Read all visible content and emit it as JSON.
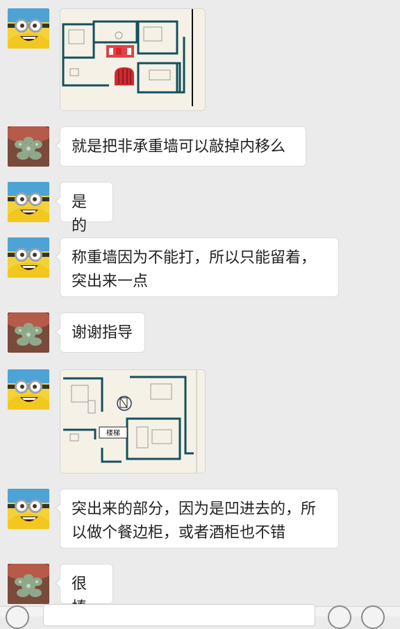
{
  "messages": [
    {
      "sender": "minion",
      "type": "image",
      "content": "floorplan-1"
    },
    {
      "sender": "succulent",
      "type": "text",
      "text": "就是把非承重墙可以敲掉内移么"
    },
    {
      "sender": "minion",
      "type": "text",
      "text": "是的"
    },
    {
      "sender": "minion",
      "type": "text",
      "text": "称重墙因为不能打，所以只能留着，\n突出来一点"
    },
    {
      "sender": "succulent",
      "type": "text",
      "text": "谢谢指导"
    },
    {
      "sender": "minion",
      "type": "image",
      "content": "floorplan-2",
      "label": "楼梯"
    },
    {
      "sender": "minion",
      "type": "text",
      "text": "突出来的部分，因为是凹进去的，所\n以做个餐边柜，或者酒柜也不错"
    },
    {
      "sender": "succulent",
      "type": "text",
      "text": "很棒"
    }
  ],
  "colors": {
    "background": "#ebebeb",
    "bubble": "#ffffff",
    "wall": "#14505e",
    "highlight": "#d8262b",
    "plan_bg": "#f5f1e6"
  },
  "icons": [
    "minion-avatar",
    "succulent-avatar",
    "voice-icon",
    "emoji-icon",
    "plus-icon"
  ]
}
